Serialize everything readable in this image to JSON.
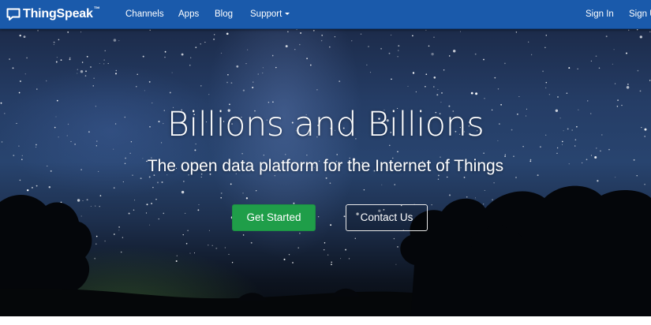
{
  "navbar": {
    "brand": {
      "name": "ThingSpeak",
      "trademark": "™",
      "icon": "speech-bubble-icon"
    },
    "links": [
      "Channels",
      "Apps",
      "Blog",
      "Support"
    ],
    "support_has_dropdown": true,
    "sign_in": "Sign In",
    "sign_up": "Sign Up",
    "background_color": "#1a5aab"
  },
  "hero": {
    "title": "Billions and Billions",
    "subtitle": "The open data platform for the Internet of Things",
    "primary_button": "Get Started",
    "secondary_button": "Contact Us",
    "primary_button_color": "#1f9e49"
  }
}
